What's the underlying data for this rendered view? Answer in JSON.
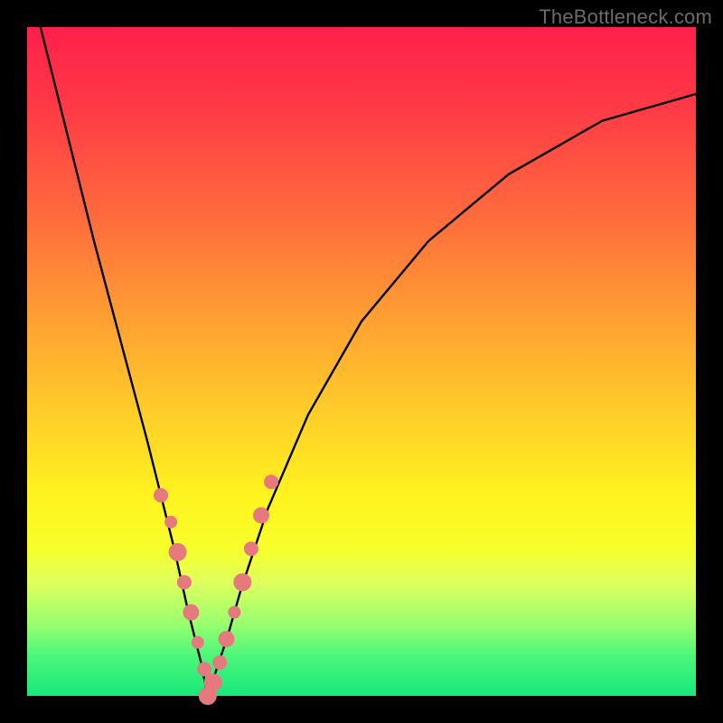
{
  "attribution": "TheBottleneck.com",
  "colors": {
    "frame": "#000000",
    "gradient_top": "#ff1f4b",
    "gradient_bottom": "#17e87a",
    "curve": "#000000",
    "marker": "#e6797e"
  },
  "chart_data": {
    "type": "line",
    "title": "",
    "xlabel": "",
    "ylabel": "",
    "xlim": [
      0,
      100
    ],
    "ylim": [
      0,
      100
    ],
    "note": "Axes unlabeled in image; values are relative percentages read from pixel positions. Curve is a V/absolute-value style dip with minimum near x≈27 at y≈0. Markers are sampled points along the lower portion of the curve.",
    "series": [
      {
        "name": "bottleneck-curve",
        "x": [
          2,
          6,
          10,
          14,
          18,
          22,
          24,
          26,
          27,
          28,
          30,
          32,
          36,
          42,
          50,
          60,
          72,
          86,
          100
        ],
        "y": [
          100,
          84,
          68,
          53,
          38,
          22,
          13,
          5,
          0,
          3,
          9,
          16,
          28,
          42,
          56,
          68,
          78,
          86,
          90
        ]
      }
    ],
    "markers": {
      "name": "sample-points",
      "x": [
        20,
        21.5,
        22.5,
        23.5,
        24.5,
        25.5,
        26.5,
        27,
        27.8,
        28.8,
        29.8,
        31,
        32.2,
        33.5,
        35,
        36.5
      ],
      "y": [
        30,
        26,
        21.5,
        17,
        12.5,
        8,
        4,
        0,
        2,
        5,
        8.5,
        12.5,
        17,
        22,
        27,
        32
      ],
      "r": [
        8,
        7,
        10,
        8,
        9,
        7,
        8,
        10,
        10,
        8,
        9,
        7,
        10,
        8,
        9,
        8
      ]
    }
  }
}
